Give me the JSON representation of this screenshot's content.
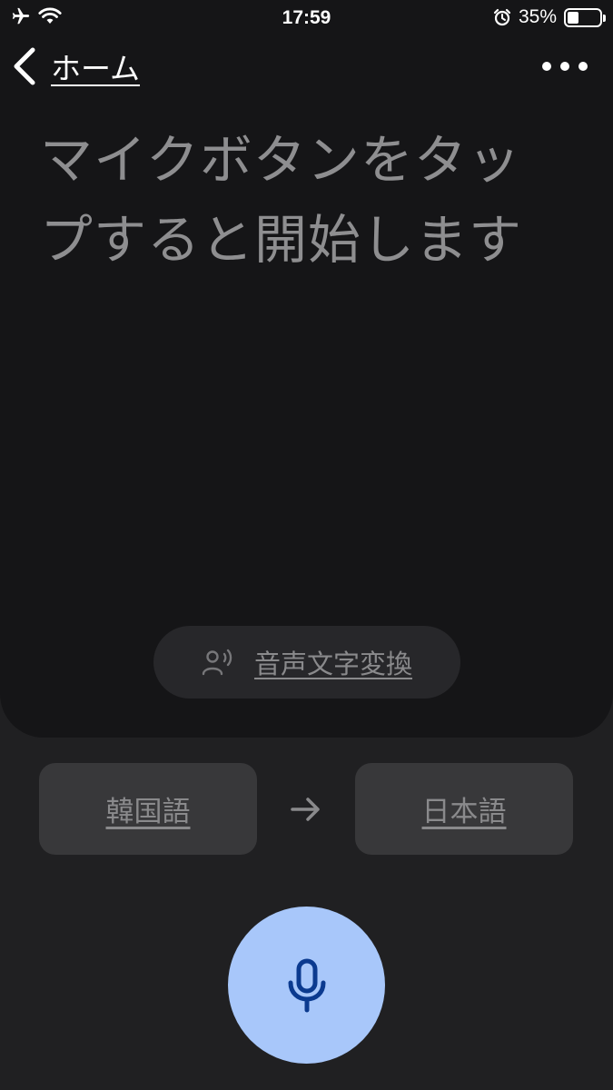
{
  "status_bar": {
    "time": "17:59",
    "battery_percent": "35%",
    "battery_level": 0.35,
    "icons": [
      "airplane-icon",
      "wifi-icon",
      "alarm-icon",
      "battery-icon"
    ]
  },
  "nav": {
    "back_label": "ホーム",
    "more_icon": "more-horizontal-icon"
  },
  "prompt": {
    "text": "マイクボタンをタップすると開始します"
  },
  "transcribe": {
    "label": "音声文字変換",
    "icon": "voice-person-icon"
  },
  "languages": {
    "source": "韓国語",
    "target": "日本語",
    "arrow_icon": "arrow-right-icon"
  },
  "mic": {
    "icon": "microphone-icon"
  },
  "colors": {
    "background": "#202022",
    "card": "#151517",
    "prompt_text": "#8e8e90",
    "lang_button": "#38383a",
    "mic_button": "#a8c7fa",
    "mic_icon": "#0b3a8f"
  }
}
